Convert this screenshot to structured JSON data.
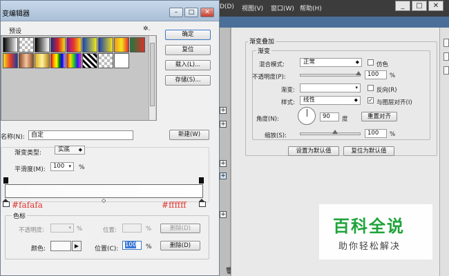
{
  "background_app": {
    "menus": [
      "D(D)",
      "视图(V)",
      "窗口(W)",
      "帮助(H)"
    ],
    "window_buttons": [
      "_",
      "□",
      "✕"
    ]
  },
  "layer_style": {
    "group_title": "渐变叠加",
    "sub_title": "渐变",
    "blend_mode_label": "混合模式:",
    "blend_mode_value": "正常",
    "dither_label": "仿色",
    "opacity_label": "不透明度(P):",
    "opacity_value": "100",
    "opacity_unit": "%",
    "gradient_label": "渐变:",
    "reverse_label": "反向(R)",
    "style_label": "样式:",
    "style_value": "线性",
    "align_label": "与图层对齐(I)",
    "align_checked": true,
    "angle_label": "角度(N):",
    "angle_value": "90",
    "angle_unit": "度",
    "reset_align_button": "重置对齐",
    "scale_label": "缩放(S):",
    "scale_value": "100",
    "scale_unit": "%",
    "set_default_button": "设置为默认值",
    "reset_default_button": "复位为默认值"
  },
  "dialog": {
    "title": "变编辑器",
    "presets_label": "预设",
    "gear_icon": "gear-icon",
    "buttons": {
      "ok": "确定",
      "reset": "复位",
      "load": "载入(L)...",
      "save": "存储(S)...",
      "new": "新建(W)"
    },
    "name_label": "名称(N):",
    "name_value": "自定",
    "gradient_type_label": "渐变类型:",
    "gradient_type_value": "实底",
    "smoothness_label": "平滑度(M):",
    "smoothness_value": "100",
    "smoothness_unit": "%",
    "hex_left": "#fafafa",
    "hex_right": "#ffffff",
    "stops": {
      "group_label": "色标",
      "opacity_label": "不透明度:",
      "opacity_unit": "%",
      "location_label_1": "位置:",
      "location_unit_1": "%",
      "delete_label_1": "删除(D)",
      "color_label": "颜色:",
      "location_label_2": "位置(C):",
      "location_value_2": "100",
      "location_unit_2": "%",
      "delete_label_2": "删除(D)",
      "color_value": "#fafafa"
    }
  },
  "watermark": {
    "title": "百科全说",
    "subtitle": "助你轻松解决"
  }
}
